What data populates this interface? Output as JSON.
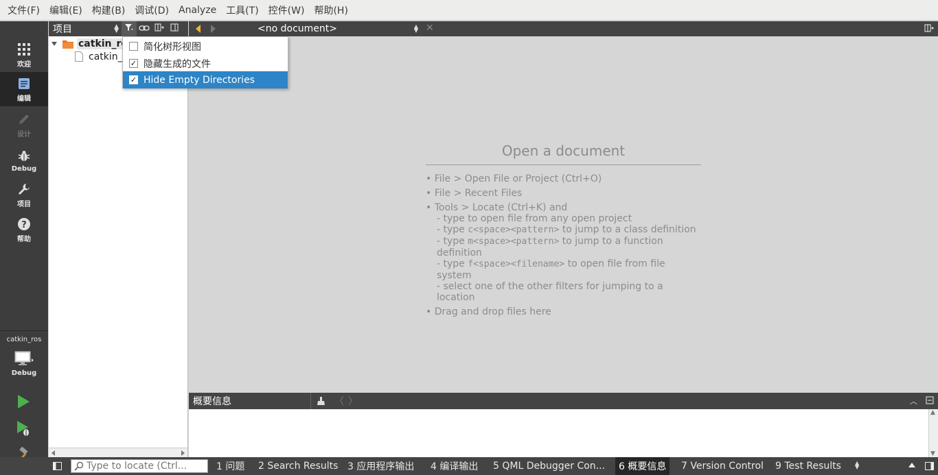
{
  "menu": [
    "文件(F)",
    "编辑(E)",
    "构建(B)",
    "调试(D)",
    "Analyze",
    "工具(T)",
    "控件(W)",
    "帮助(H)"
  ],
  "modes": [
    {
      "label": "欢迎",
      "icon": "grid-icon"
    },
    {
      "label": "编辑",
      "icon": "document-edit-icon",
      "active": true
    },
    {
      "label": "设计",
      "icon": "pencil-icon",
      "disabled": true
    },
    {
      "label": "Debug",
      "icon": "bug-icon"
    },
    {
      "label": "项目",
      "icon": "wrench-icon"
    },
    {
      "label": "帮助",
      "icon": "help-icon"
    }
  ],
  "kit": {
    "name": "catkin_ros",
    "build": "Debug"
  },
  "project_pane": {
    "title": "项目"
  },
  "tree": {
    "root": "catkin_ros",
    "child": "catkin_"
  },
  "filter_menu": [
    {
      "label": "简化树形视图",
      "checked": false
    },
    {
      "label": "隐藏生成的文件",
      "checked": true
    },
    {
      "label": "Hide Empty Directories",
      "checked": true,
      "highlighted": true
    }
  ],
  "editor_toolbar": {
    "document": "<no document>"
  },
  "welcome": {
    "title": "Open a document",
    "hint1": "• File > Open File or Project (Ctrl+O)",
    "hint2": "• File > Recent Files",
    "hint3": "• Tools > Locate (Ctrl+K) and",
    "sub1": "- type to open file from any open project",
    "sub2_pre": "- type ",
    "sub2_code": "c<space><pattern>",
    "sub2_post": " to jump to a class definition",
    "sub3_pre": "- type ",
    "sub3_code": "m<space><pattern>",
    "sub3_post": " to jump to a function definition",
    "sub4_pre": "- type ",
    "sub4_code": "f<space><filename>",
    "sub4_post": " to open file from file system",
    "sub5": "- select one of the other filters for jumping to a location",
    "hint4": "• Drag and drop files here"
  },
  "output_pane": {
    "title": "概要信息"
  },
  "locator": {
    "placeholder": "Type to locate (Ctrl..."
  },
  "output_tabs": [
    {
      "label": "1 问题"
    },
    {
      "label": "2 Search Results"
    },
    {
      "label": "3 应用程序输出"
    },
    {
      "label": "4 编译输出"
    },
    {
      "label": "5 QML Debugger Con..."
    },
    {
      "label": "6 概要信息",
      "active": true
    },
    {
      "label": "7 Version Control"
    },
    {
      "label": "9 Test Results"
    }
  ],
  "colors": {
    "highlight": "#2d84c6",
    "modebar": "#3d3d3d",
    "toolbar": "#444444",
    "run_green": "#4caf50"
  }
}
